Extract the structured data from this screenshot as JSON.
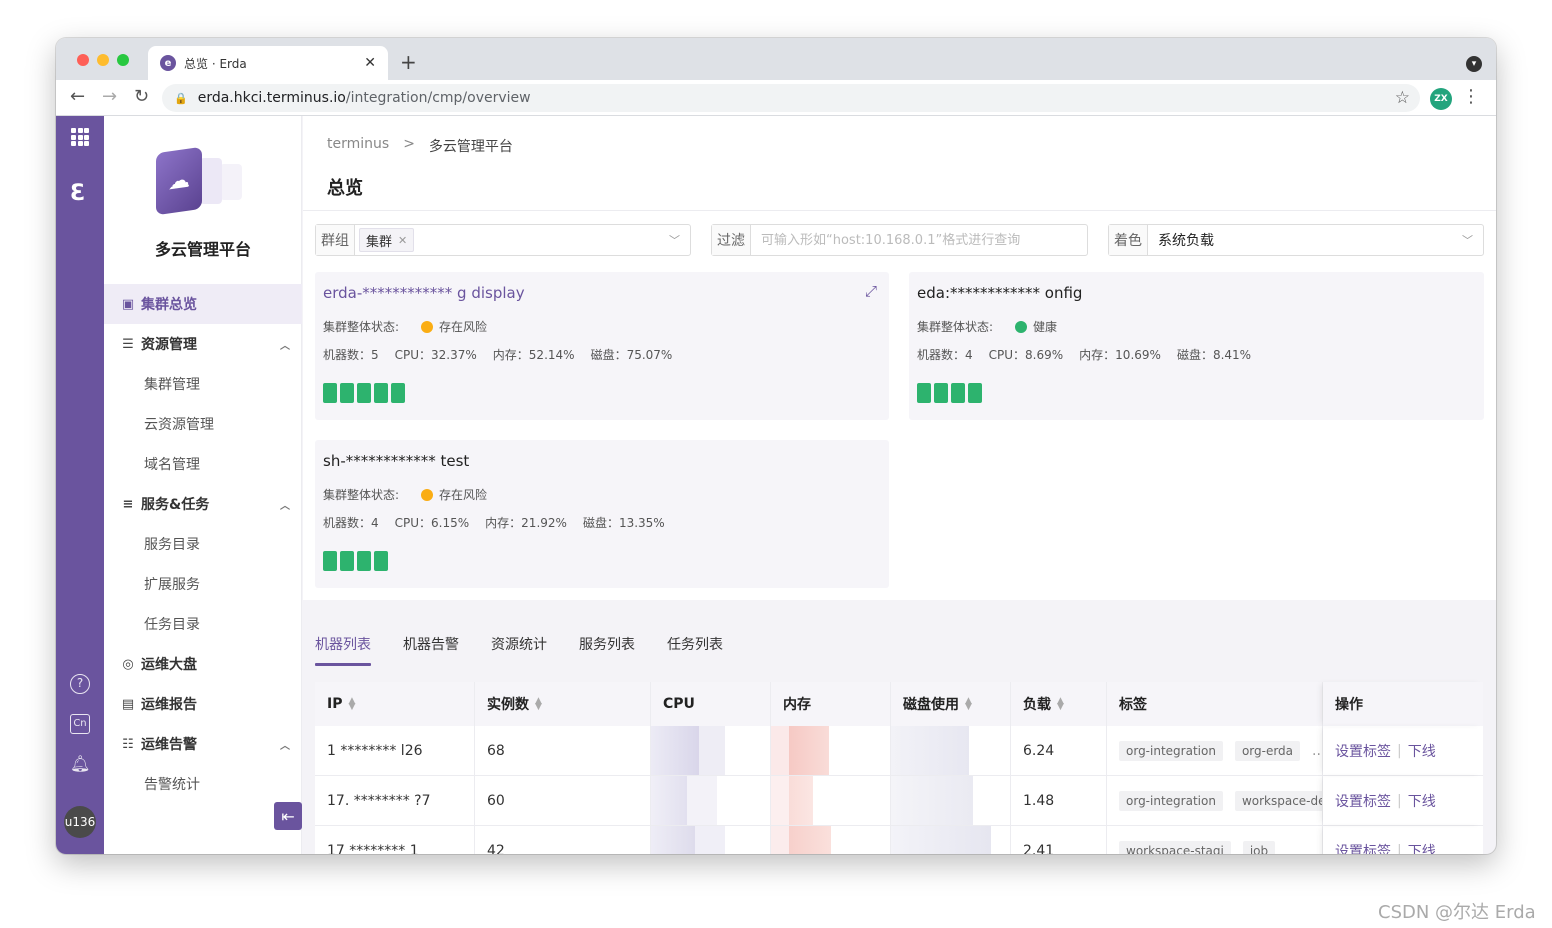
{
  "browser": {
    "tab_title": "总览 · Erda",
    "new_tab": "+",
    "url_host": "erda.hkci.terminus.io",
    "url_path": "/integration/cmp/overview",
    "user_initials": "ZX"
  },
  "rail": {
    "user": "u136",
    "lang": "Cn"
  },
  "sidebar": {
    "platform_name": "多云管理平台",
    "items": [
      {
        "label": "集群总览",
        "icon": "overview-icon",
        "kind": "active"
      },
      {
        "label": "资源管理",
        "icon": "database-icon",
        "kind": "group"
      },
      {
        "label": "集群管理",
        "kind": "sub"
      },
      {
        "label": "云资源管理",
        "kind": "sub"
      },
      {
        "label": "域名管理",
        "kind": "sub"
      },
      {
        "label": "服务&任务",
        "icon": "list-icon",
        "kind": "group"
      },
      {
        "label": "服务目录",
        "kind": "sub"
      },
      {
        "label": "扩展服务",
        "kind": "sub"
      },
      {
        "label": "任务目录",
        "kind": "sub"
      },
      {
        "label": "运维大盘",
        "icon": "dashboard-icon",
        "kind": "item"
      },
      {
        "label": "运维报告",
        "icon": "report-icon",
        "kind": "item"
      },
      {
        "label": "运维告警",
        "icon": "alarm-icon",
        "kind": "group"
      },
      {
        "label": "告警统计",
        "kind": "sub"
      }
    ]
  },
  "breadcrumb": {
    "root": "terminus",
    "sep": ">",
    "current": "多云管理平台"
  },
  "page_title": "总览",
  "filters": {
    "group_label": "群组",
    "group_tag": "集群",
    "filter_label": "过滤",
    "filter_placeholder": "可输入形如“host:10.168.0.1”格式进行查询",
    "color_label": "着色",
    "color_value": "系统负载"
  },
  "clusters": [
    {
      "name": "erda-************ g display",
      "status_label": "集群整体状态:",
      "status": "存在风险",
      "status_color": "#faad14",
      "stats": [
        "机器数：5",
        "CPU：32.37%",
        "内存：52.14%",
        "磁盘：75.07%"
      ],
      "nodes": 5
    },
    {
      "name": "eda:************ onfig",
      "status_label": "集群整体状态:",
      "status": "健康",
      "status_color": "#2db36e",
      "stats": [
        "机器数：4",
        "CPU：8.69%",
        "内存：10.69%",
        "磁盘：8.41%"
      ],
      "nodes": 4
    },
    {
      "name": "sh-************ test",
      "status_label": "集群整体状态:",
      "status": "存在风险",
      "status_color": "#faad14",
      "stats": [
        "机器数：4",
        "CPU：6.15%",
        "内存：21.92%",
        "磁盘：13.35%"
      ],
      "nodes": 4
    }
  ],
  "tabs": [
    "机器列表",
    "机器告警",
    "资源统计",
    "服务列表",
    "任务列表"
  ],
  "table": {
    "headers": {
      "ip": "IP",
      "instances": "实例数",
      "cpu": "CPU",
      "mem": "内存",
      "disk": "磁盘使用",
      "load": "负载",
      "tags": "标签",
      "ops": "操作"
    },
    "rows": [
      {
        "ip": "1 ******** l26",
        "instances": "68",
        "load": "6.24",
        "tags": [
          "org-integration",
          "org-erda",
          "..."
        ]
      },
      {
        "ip": "17. ******** ?7",
        "instances": "60",
        "load": "1.48",
        "tags": [
          "org-integration",
          "workspace-dev"
        ]
      },
      {
        "ip": "17 ******** 1",
        "instances": "42",
        "load": "2.41",
        "tags": [
          "workspace-stagi",
          "job"
        ]
      }
    ],
    "op_set_tags": "设置标签",
    "op_offline": "下线"
  },
  "watermark": "CSDN @尔达 Erda"
}
